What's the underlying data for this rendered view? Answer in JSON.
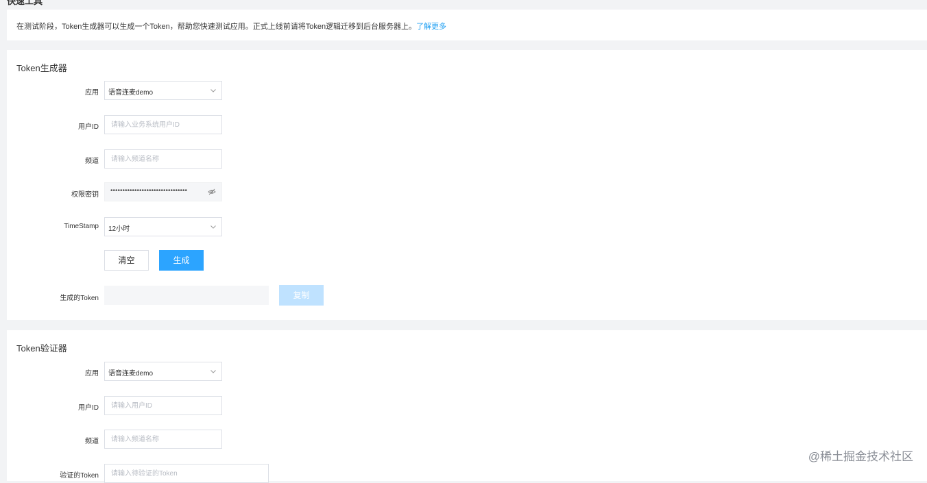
{
  "page": {
    "cut_title": "快速工具"
  },
  "notice": {
    "text": "在测试阶段，Token生成器可以生成一个Token，帮助您快速测试应用。正式上线前请将Token逻辑迁移到后台服务器上。",
    "link": "了解更多"
  },
  "generator": {
    "title": "Token生成器",
    "app_label": "应用",
    "app_value": "语音连麦demo",
    "userid_label": "用户ID",
    "userid_placeholder": "请输入业务系统用户ID",
    "channel_label": "频道",
    "channel_placeholder": "请输入频道名称",
    "secret_label": "权限密钥",
    "secret_value": "••••••••••••••••••••••••••••••••",
    "timestamp_label": "TimeStamp",
    "timestamp_value": "12小时",
    "clear_button": "清空",
    "generate_button": "生成",
    "token_label": "生成的Token",
    "copy_button": "复制"
  },
  "validator": {
    "title": "Token验证器",
    "app_label": "应用",
    "app_value": "语音连麦demo",
    "userid_label": "用户ID",
    "userid_placeholder": "请输入用户ID",
    "channel_label": "频道",
    "channel_placeholder": "请输入频道名称",
    "token_label": "验证的Token",
    "token_placeholder": "请输入待验证的Token"
  },
  "watermark": "@稀土掘金技术社区",
  "colors": {
    "accent": "#2ca4ff",
    "accent_disabled": "#bfe2ff",
    "link": "#1e9ff2",
    "background": "#f2f3f5"
  },
  "icons": {
    "select_arrow": "chevron-down-icon",
    "secret_toggle": "eye-off-icon"
  }
}
